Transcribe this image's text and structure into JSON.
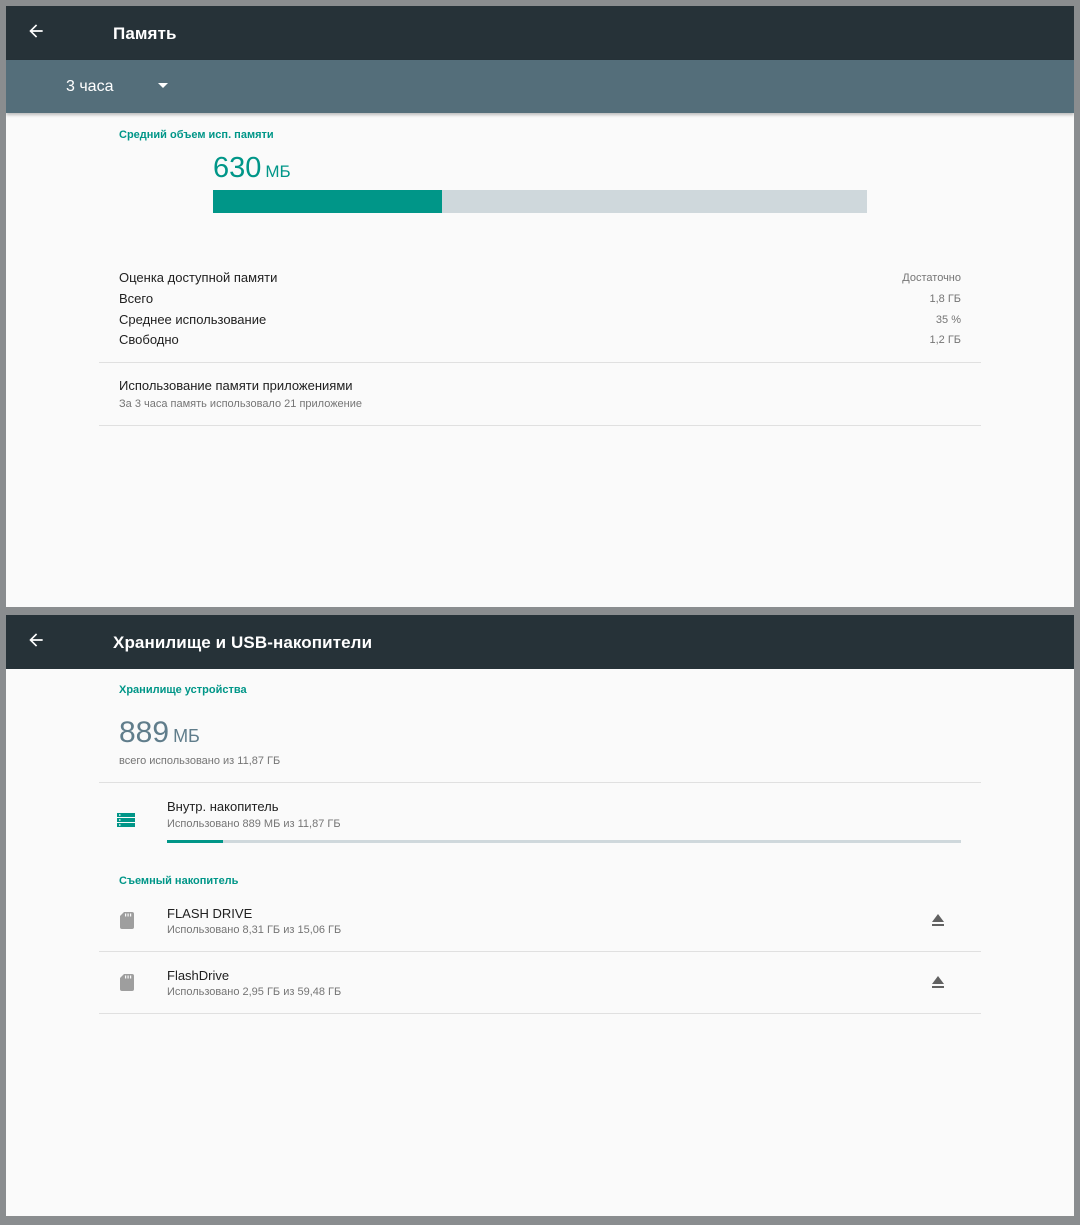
{
  "memory": {
    "title": "Память",
    "period": "3 часа",
    "avg_header": "Средний объем исп. памяти",
    "avg_value": "630",
    "avg_unit": "МБ",
    "usage_fraction": 0.35,
    "stats": [
      {
        "label": "Оценка доступной памяти",
        "value": "Достаточно"
      },
      {
        "label": "Всего",
        "value": "1,8 ГБ"
      },
      {
        "label": "Среднее использование",
        "value": "35 %"
      },
      {
        "label": "Свободно",
        "value": "1,2 ГБ"
      }
    ],
    "apps_title": "Использование памяти приложениями",
    "apps_subtitle": "За 3 часа память использовало 21 приложение"
  },
  "storage": {
    "title": "Хранилище и USB-накопители",
    "device_header": "Хранилище устройства",
    "used_value": "889",
    "used_unit": "МБ",
    "used_caption": "всего использовано из 11,87 ГБ",
    "internal": {
      "title": "Внутр. накопитель",
      "subtitle": "Использовано 889 МБ из 11,87 ГБ",
      "fraction": 0.07
    },
    "removable_header": "Съемный накопитель",
    "removable": [
      {
        "title": "FLASH DRIVE",
        "subtitle": "Использовано 8,31 ГБ из 15,06 ГБ"
      },
      {
        "title": "FlashDrive",
        "subtitle": "Использовано 2,95 ГБ из 59,48 ГБ"
      }
    ]
  },
  "colors": {
    "accent": "#009688",
    "appbar": "#263238",
    "subbar": "#546e7a",
    "track": "#cfd8dc"
  },
  "icons": [
    "back-arrow-icon",
    "dropdown-caret-icon",
    "storage-list-icon",
    "sd-card-icon",
    "eject-icon"
  ]
}
